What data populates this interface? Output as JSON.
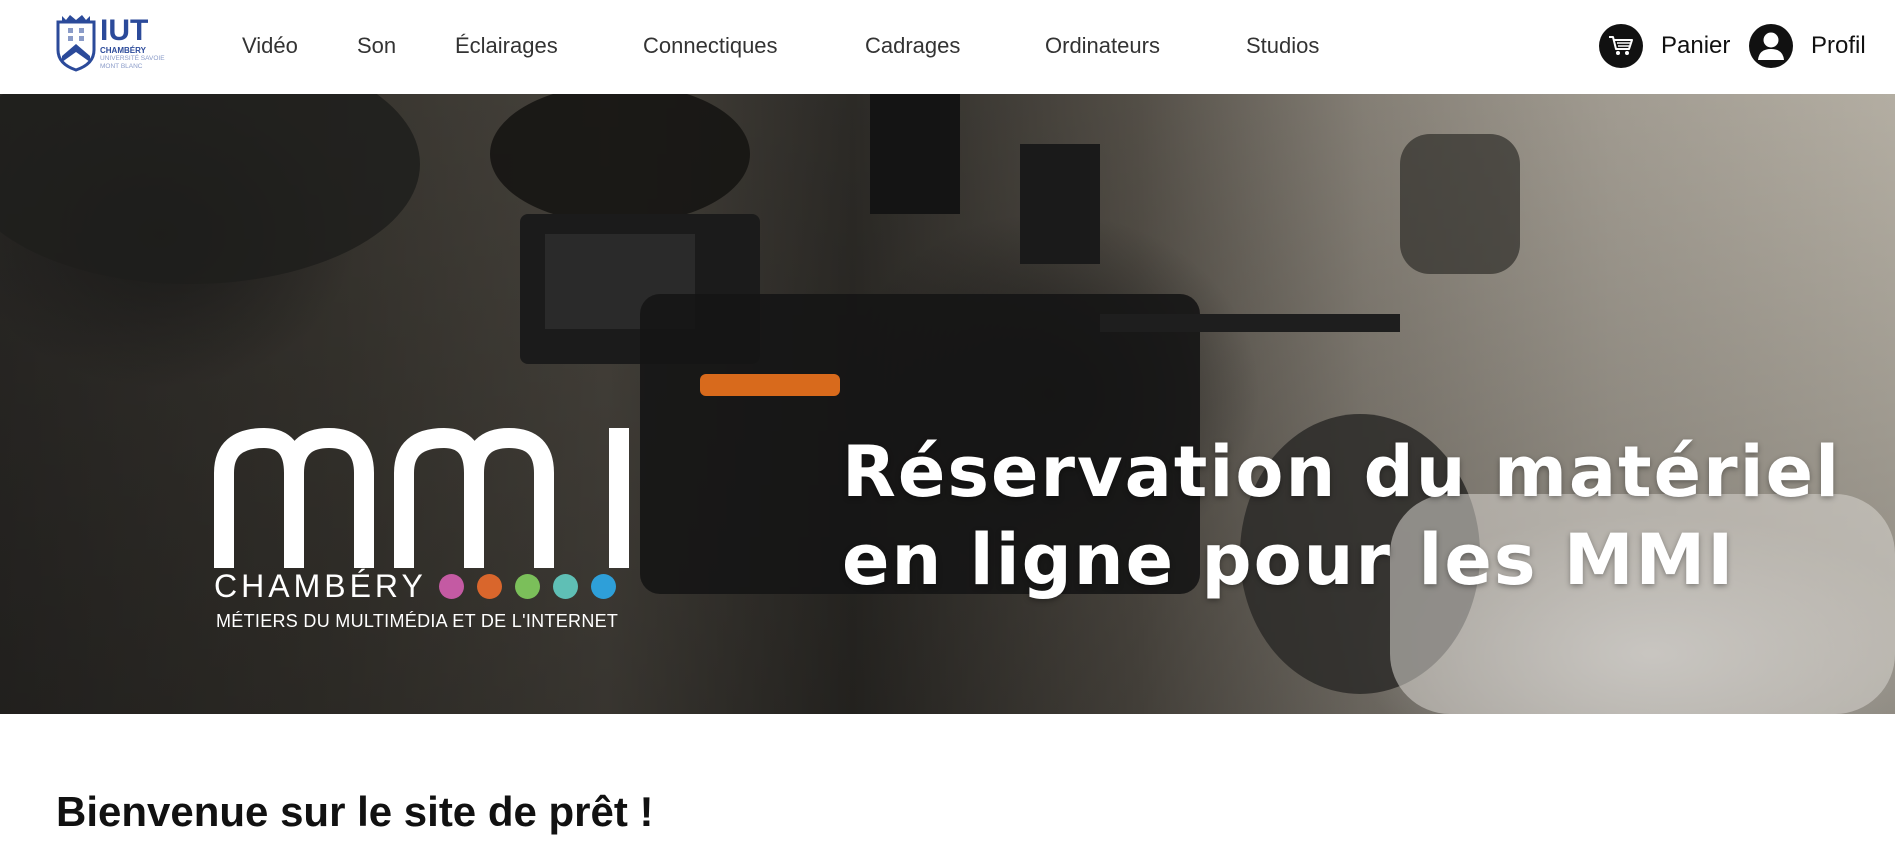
{
  "logo": {
    "main": "IUT",
    "line1": "CHAMBÉRY",
    "line2": "UNIVERSITÉ SAVOIE",
    "line3": "MONT BLANC"
  },
  "nav": {
    "items": [
      {
        "label": "Vidéo"
      },
      {
        "label": "Son"
      },
      {
        "label": "Éclairages"
      },
      {
        "label": "Connectiques"
      },
      {
        "label": "Cadrages"
      },
      {
        "label": "Ordinateurs"
      },
      {
        "label": "Studios"
      }
    ]
  },
  "header_actions": {
    "cart_label": "Panier",
    "cart_icon": "cart-icon",
    "profile_label": "Profil",
    "profile_icon": "user-icon"
  },
  "hero": {
    "mmi_city": "CHAMBÉRY",
    "mmi_tagline": "MÉTIERS DU MULTIMÉDIA ET DE L'INTERNET",
    "title_line1": "Réservation du matériel",
    "title_line2": "en ligne pour les MMI",
    "dot_colors": [
      "#c45aa3",
      "#d9662c",
      "#7bbf5a",
      "#5fbfb5",
      "#2e9fd9"
    ]
  },
  "welcome": {
    "heading": "Bienvenue sur le site de prêt !"
  },
  "colors": {
    "brand_blue": "#2b4a9a",
    "text_dark": "#111111"
  }
}
